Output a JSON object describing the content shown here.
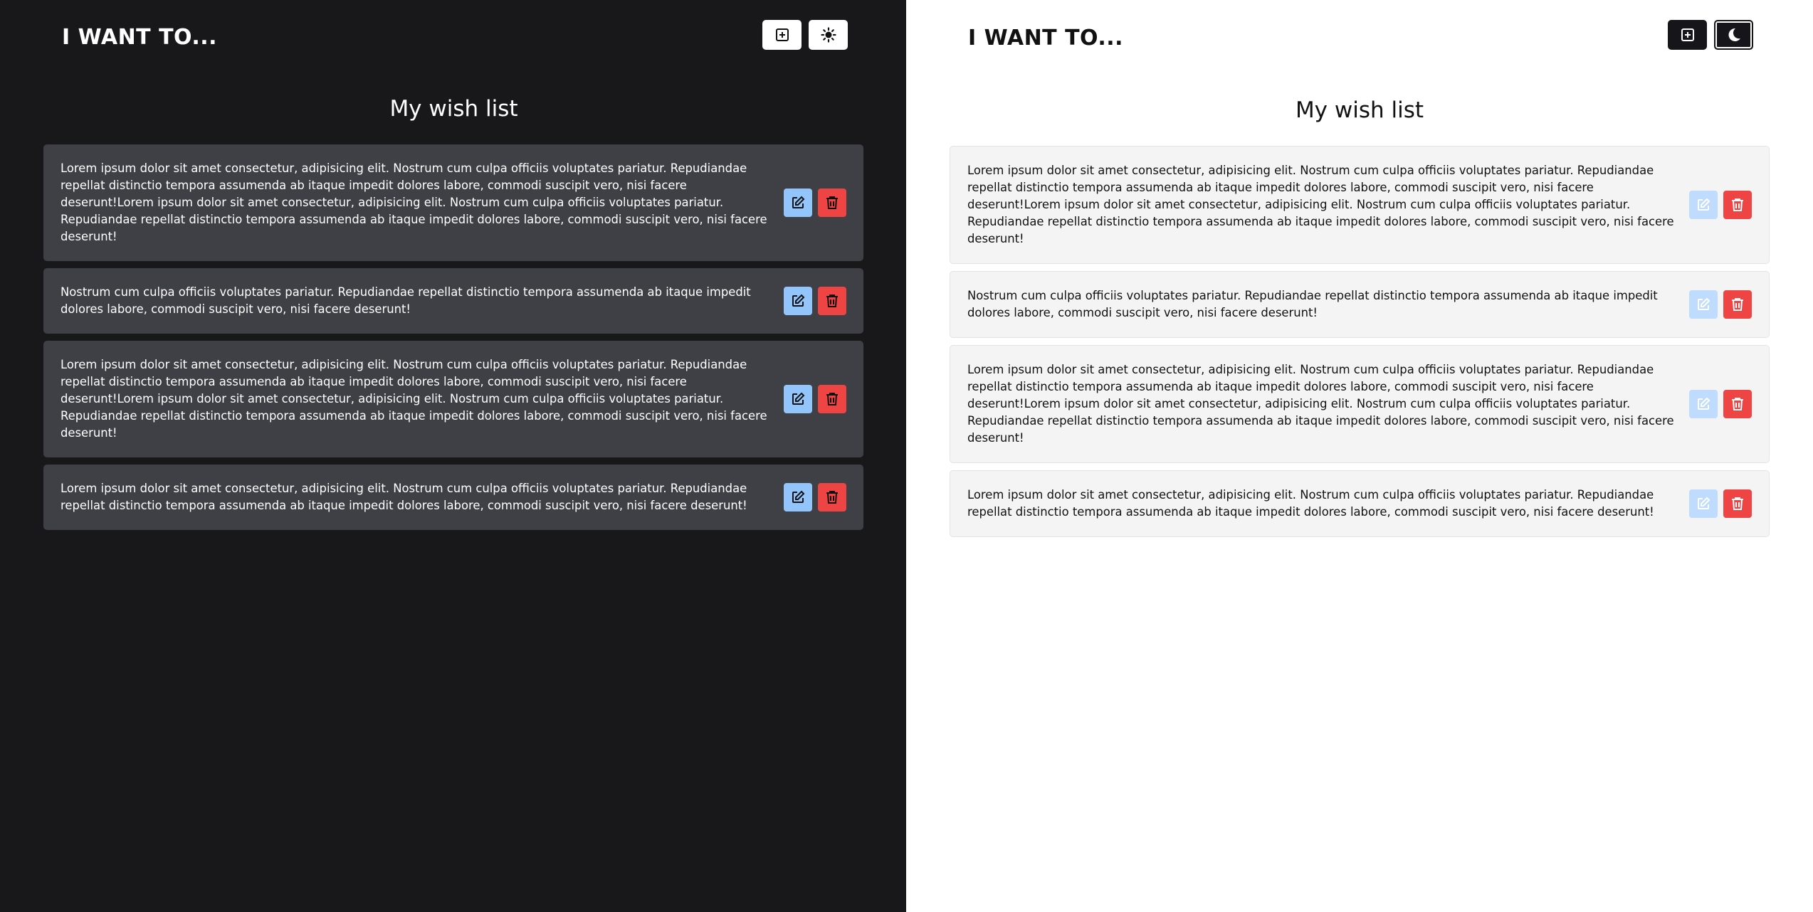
{
  "dark_panel": {
    "logo": "I WANT TO...",
    "heading": "My wish list",
    "add_icon": "plus-square-icon",
    "theme_icon": "sun-icon"
  },
  "light_panel": {
    "logo": "I WANT TO...",
    "heading": "My wish list",
    "add_icon": "plus-square-icon",
    "theme_icon": "moon-icon"
  },
  "items": [
    {
      "text": "Lorem ipsum dolor sit amet consectetur, adipisicing elit. Nostrum cum culpa officiis voluptates pariatur. Repudiandae repellat distinctio tempora assumenda ab itaque impedit dolores labore, commodi suscipit vero, nisi facere deserunt!Lorem ipsum dolor sit amet consectetur, adipisicing elit. Nostrum cum culpa officiis voluptates pariatur. Repudiandae repellat distinctio tempora assumenda ab itaque impedit dolores labore, commodi suscipit vero, nisi facere deserunt!"
    },
    {
      "text": "Nostrum cum culpa officiis voluptates pariatur. Repudiandae repellat distinctio tempora assumenda ab itaque impedit dolores labore, commodi suscipit vero, nisi facere deserunt!"
    },
    {
      "text": "Lorem ipsum dolor sit amet consectetur, adipisicing elit. Nostrum cum culpa officiis voluptates pariatur. Repudiandae repellat distinctio tempora assumenda ab itaque impedit dolores labore, commodi suscipit vero, nisi facere deserunt!Lorem ipsum dolor sit amet consectetur, adipisicing elit. Nostrum cum culpa officiis voluptates pariatur. Repudiandae repellat distinctio tempora assumenda ab itaque impedit dolores labore, commodi suscipit vero, nisi facere deserunt!"
    },
    {
      "text": "Lorem ipsum dolor sit amet consectetur, adipisicing elit. Nostrum cum culpa officiis voluptates pariatur. Repudiandae repellat distinctio tempora assumenda ab itaque impedit dolores labore, commodi suscipit vero, nisi facere deserunt!"
    }
  ],
  "icons": {
    "edit": "edit-icon",
    "delete": "trash-icon"
  },
  "colors": {
    "dark_bg": "#18181b",
    "dark_card": "#3f3f46",
    "light_card": "#f4f4f5",
    "edit": "#93c5fd",
    "delete": "#ef4444"
  }
}
